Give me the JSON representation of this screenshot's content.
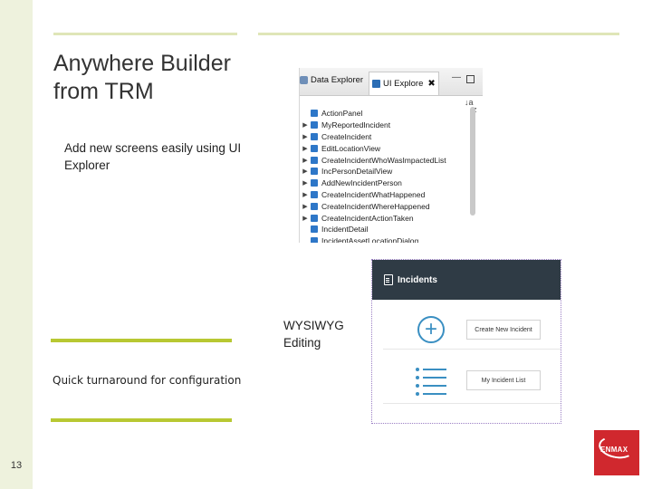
{
  "slide": {
    "title_line1": "Anywhere Builder",
    "title_line2": "from TRM",
    "text_ui_explorer": "Add new screens easily using UI Explorer",
    "text_wysiwyg_line1": "WYSIWYG",
    "text_wysiwyg_line2": "Editing",
    "text_quick": "Quick turnaround for configuration",
    "page_number": "13",
    "accent_color": "#b8c832",
    "strip_color": "#eef2dd"
  },
  "explorer": {
    "tab_data": "Data Explorer",
    "tab_ui": "UI Explore",
    "tab_ui_close": "✖",
    "items": [
      "ActionPanel",
      "MyReportedIncident",
      "CreateIncident",
      "EditLocationView",
      "CreateIncidentWhoWasImpactedList",
      "IncPersonDetailView",
      "AddNewIncidentPerson",
      "CreateIncidentWhatHappened",
      "CreateIncidentWhereHappened",
      "CreateIncidentActionTaken",
      "IncidentDetail",
      "IncidentAssetLocationDialog"
    ]
  },
  "wysiwyg": {
    "header_title": "Incidents",
    "button1": "Create New Incident",
    "button2": "My Incident List",
    "header_color": "#2f3b45",
    "icon_color": "#3a8fc2"
  },
  "logo": {
    "text": "ENMAX",
    "color": "#d0282e"
  }
}
